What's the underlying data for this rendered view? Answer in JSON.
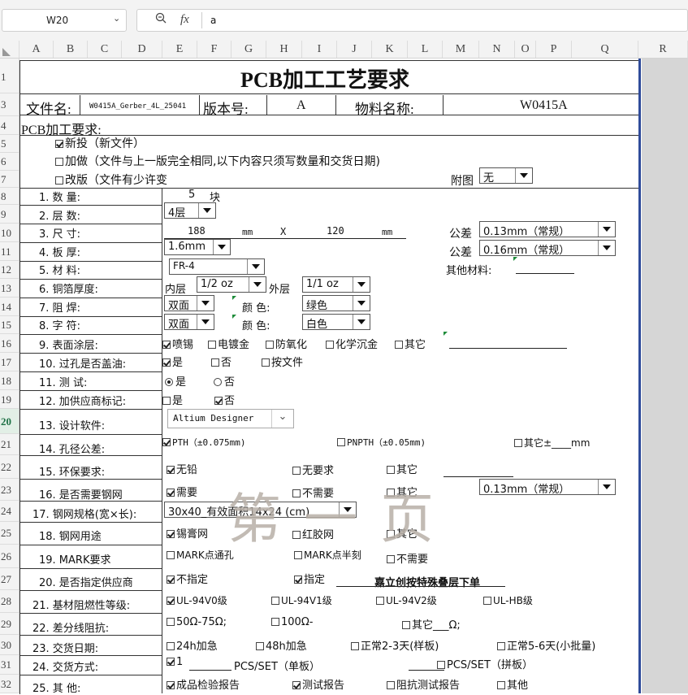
{
  "formula_bar": {
    "cell_ref": "W20",
    "fx_label": "fx",
    "content": "a"
  },
  "columns": [
    "A",
    "B",
    "C",
    "D",
    "E",
    "F",
    "G",
    "H",
    "I",
    "J",
    "K",
    "L",
    "M",
    "N",
    "O",
    "P",
    "Q",
    "R"
  ],
  "rows": [
    "1",
    "3",
    "4",
    "5",
    "6",
    "7",
    "8",
    "9",
    "10",
    "11",
    "12",
    "13",
    "14",
    "15",
    "16",
    "17",
    "18",
    "19",
    "20",
    "21",
    "22",
    "23",
    "24",
    "25",
    "26",
    "27",
    "28",
    "29",
    "30",
    "31",
    "32"
  ],
  "selected_row": "20",
  "sheet": {
    "title": "PCB加工工艺要求",
    "file_label": "文件名:",
    "file_value": "W0415A_Gerber_4L_25041",
    "version_label": "版本号:",
    "version_value": "A",
    "material_label": "物料名称:",
    "material_value": "W0415A",
    "req_label": "PCB加工要求:",
    "opt_new": "新投（新文件）",
    "opt_add": "加做（文件与上一版完全相同,以下内容只须写数量和交货日期)",
    "opt_mod": "改版（文件有少许变",
    "attach_label": "附图",
    "attach_value": "无",
    "r1_label": "1. 数        量:",
    "qty": "5",
    "qty_unit": "块",
    "r2_label": "2. 层        数:",
    "layers": "4层",
    "r3_label": "3. 尺        寸:",
    "dim_w": "188",
    "dim_unit1": "mm",
    "dim_x": "X",
    "dim_h": "120",
    "dim_unit2": "mm",
    "tol_label": "公差",
    "tol1": "0.13mm（常规）",
    "r4_label": "4. 板        厚:",
    "thickness": "1.6mm",
    "tol2_label": "公差",
    "tol2": "0.16mm（常规）",
    "r5_label": "5. 材        料:",
    "material": "FR-4",
    "other_mat_label": "其他材料:",
    "r6_label": "6. 铜箔厚度:",
    "inner_label": "内层",
    "inner": "1/2 oz",
    "outer_label": "外层",
    "outer": "1/1 oz",
    "r7_label": "7. 阻        焊:",
    "mask_side": "双面",
    "color_label": "颜    色:",
    "mask_color": "绿色",
    "r8_label": "8. 字        符:",
    "silk_side": "双面",
    "color_label2": "颜    色:",
    "silk_color": "白色",
    "r9_label": "9. 表面涂层:",
    "s_hasl": "喷锡",
    "s_gold": "电镀金",
    "s_osp": "防氧化",
    "s_enig": "化学沉金",
    "s_other": "其它",
    "r10_label": "10. 过孔是否盖油:",
    "via_yes": "是",
    "via_no": "否",
    "via_file": "按文件",
    "r11_label": "11. 测        试:",
    "test_yes": "是",
    "test_no": "否",
    "r12_label": "12. 加供应商标记:",
    "mark_yes": "是",
    "mark_no": "否",
    "r13_label": "13. 设计软件:",
    "software": "Altium Designer",
    "r14_label": "14. 孔径公差:",
    "pth": "PTH（±0.075mm)",
    "npth": "PNPTH（±0.05mm)",
    "hole_other": "其它±____mm",
    "r15_label": "15. 环保要求:",
    "env_pb": "无铅",
    "env_none": "无要求",
    "env_other": "其它",
    "r16_label": "16. 是否需要钢网",
    "sten_need": "需要",
    "sten_noneed": "不需要",
    "sten_other": "其它",
    "sten_tol": "0.13mm（常规）",
    "r17_label": "17. 钢网规格(宽×长):",
    "sten_size": "30x40_有效面积14x24 (cm)",
    "r18_label": "18. 钢网用途",
    "use_solder": "锡膏网",
    "use_glue": "红胶网",
    "use_other": "其它",
    "r19_label": "19. MARK要求",
    "mark_through": "MARK点通孔",
    "mark_half": "MARK点半刻",
    "mark_none": "不需要",
    "r20_label": "20. 是否指定供应商",
    "sup_no": "不指定",
    "sup_yes": "指定",
    "sup_name": "嘉立创按特殊叠层下单",
    "r21_label": "21. 基材阻燃性等级:",
    "ul0": "UL-94V0级",
    "ul1": "UL-94V1级",
    "ul2": "UL-94V2级",
    "ulhb": "UL-HB级",
    "r22_label": "22. 差分线阻抗:",
    "imp1": "50Ω-75Ω;",
    "imp2": "100Ω-",
    "imp3": "其它___Ω;",
    "r23_label": "23. 交货日期:",
    "d24": "24h加急",
    "d48": "48h加急",
    "d23": "正常2-3天(样板)",
    "d56": "正常5-6天(小批量)",
    "r24_label": "24. 交货方式:",
    "pcs_num": "1",
    "pcs_single": "PCS/SET（单板）",
    "pcs_panel": "PCS/SET（拼板）",
    "r25_label": "25. 其        他:",
    "o_report": "成品检验报告",
    "o_test": "测试报告",
    "o_imp": "阻抗测试报告",
    "o_other": "其他"
  },
  "watermark": "第一页"
}
